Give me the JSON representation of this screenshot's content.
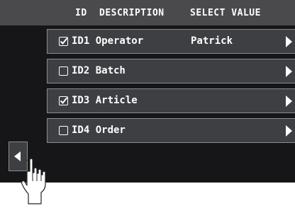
{
  "header": {
    "col_id": "ID",
    "col_description": "DESCRIPTION",
    "col_select_value": "SELECT VALUE"
  },
  "rows": [
    {
      "label": "ID1 Operator",
      "value": "Patrick",
      "checked": true
    },
    {
      "label": "ID2 Batch",
      "value": "",
      "checked": false
    },
    {
      "label": "ID3 Article",
      "value": "",
      "checked": true
    },
    {
      "label": "ID4 Order",
      "value": "",
      "checked": false
    }
  ],
  "colors": {
    "header_bg": "#4a4a4c",
    "body_bg": "#161618",
    "row_bg": "#3e3f42",
    "row_border": "#8a8c90",
    "text": "#ffffff"
  },
  "icons": {
    "row_arrow": "triangle-right-icon",
    "back": "triangle-left-icon",
    "pointer": "hand-pointer-icon",
    "checked": "checkbox-checked-icon",
    "unchecked": "checkbox-empty-icon"
  }
}
